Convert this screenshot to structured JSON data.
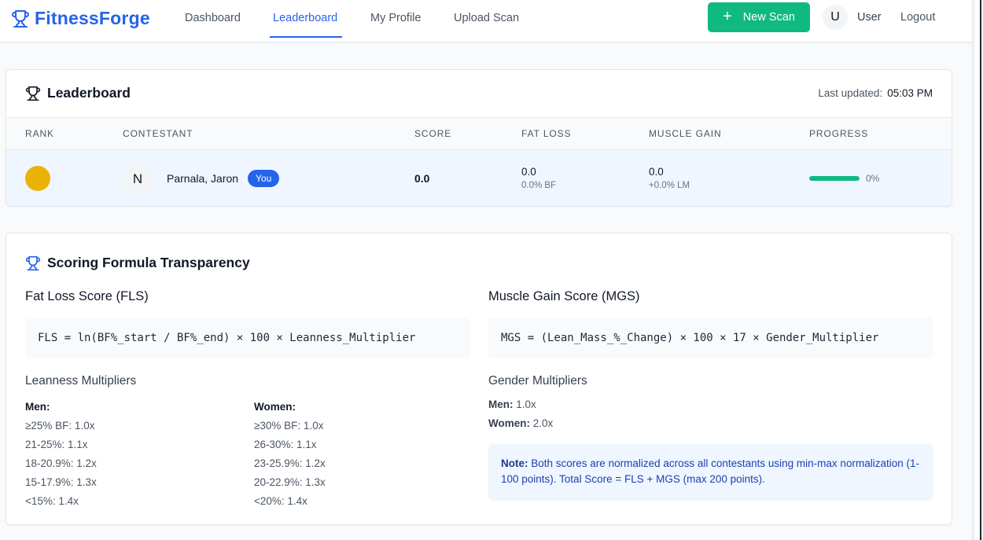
{
  "header": {
    "brand": "FitnessForge",
    "nav": [
      "Dashboard",
      "Leaderboard",
      "My Profile",
      "Upload Scan"
    ],
    "active_nav": "Leaderboard",
    "new_scan_label": "New Scan",
    "avatar_initial": "U",
    "user_name": "User",
    "logout_label": "Logout"
  },
  "leaderboard": {
    "title": "Leaderboard",
    "last_updated_label": "Last updated:",
    "last_updated_time": "05:03 PM",
    "columns": [
      "RANK",
      "CONTESTANT",
      "SCORE",
      "FAT LOSS",
      "MUSCLE GAIN",
      "PROGRESS"
    ],
    "rows": [
      {
        "rank_color": "#eab308",
        "avatar_initial": "N",
        "name": "Parnala, Jaron",
        "badge": "You",
        "score": "0.0",
        "fat_loss": "0.0",
        "fat_loss_sub": "0.0% BF",
        "muscle_gain": "0.0",
        "muscle_gain_sub": "+0.0% LM",
        "progress_fraction": 1.0,
        "progress_text": "0%"
      }
    ]
  },
  "scoring": {
    "title": "Scoring Formula Transparency",
    "fls_title": "Fat Loss Score (FLS)",
    "fls_formula": "FLS = ln(BF%_start / BF%_end) × 100 × Leanness_Multiplier",
    "mgs_title": "Muscle Gain Score (MGS)",
    "mgs_formula": "MGS = (Lean_Mass_%_Change) × 100 × 17 × Gender_Multiplier",
    "leanness_title": "Leanness Multipliers",
    "men_label": "Men:",
    "men": [
      "≥25% BF: 1.0x",
      "21-25%: 1.1x",
      "18-20.9%: 1.2x",
      "15-17.9%: 1.3x",
      "<15%: 1.4x"
    ],
    "women_label": "Women:",
    "women": [
      "≥30% BF: 1.0x",
      "26-30%: 1.1x",
      "23-25.9%: 1.2x",
      "20-22.9%: 1.3x",
      "<20%: 1.4x"
    ],
    "gender_title": "Gender Multipliers",
    "gender_men_label": "Men:",
    "gender_men_value": "1.0x",
    "gender_women_label": "Women:",
    "gender_women_value": "2.0x",
    "note_label": "Note:",
    "note_text": "Both scores are normalized across all contestants using min-max normalization (1-100 points). Total Score = FLS + MGS (max 200 points)."
  },
  "colors": {
    "brand": "#2563eb",
    "success": "#10b981",
    "gold": "#eab308"
  },
  "icons": [
    "trophy-icon",
    "plus-icon"
  ]
}
